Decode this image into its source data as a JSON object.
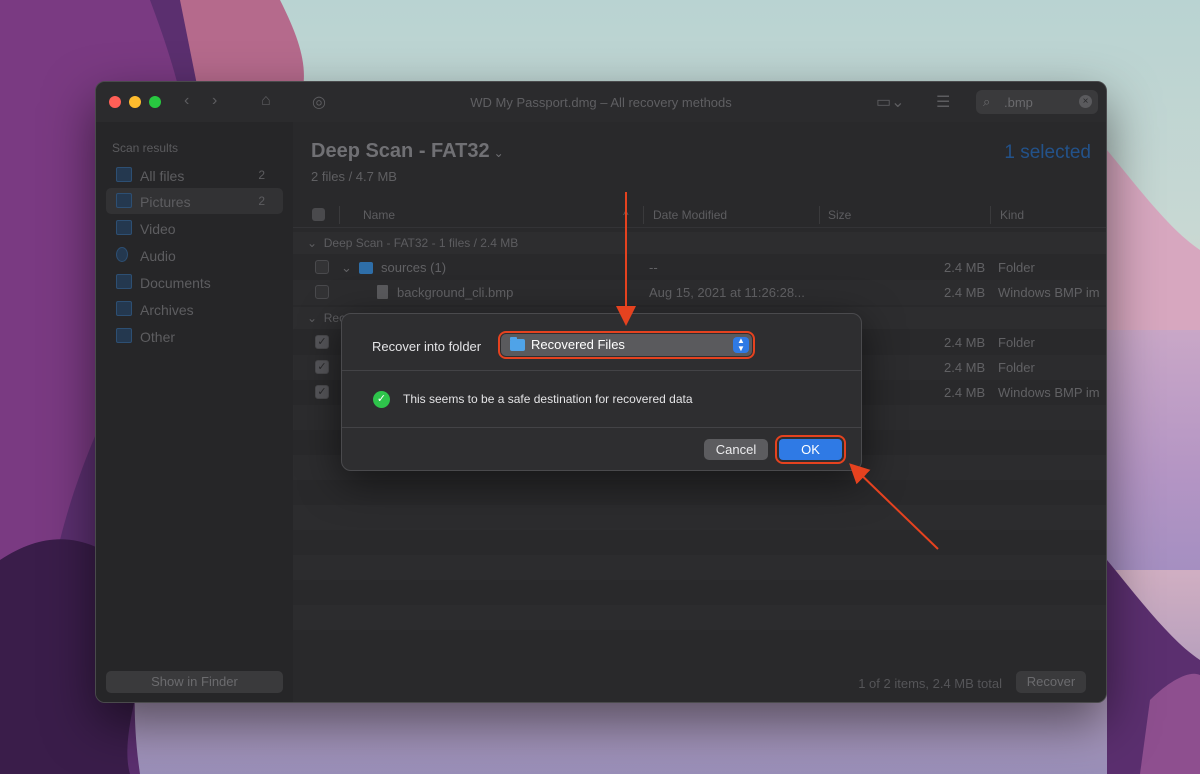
{
  "window": {
    "title": "WD My Passport.dmg – All recovery methods",
    "search_value": ".bmp"
  },
  "sidebar": {
    "header": "Scan results",
    "items": [
      {
        "label": "All files",
        "count": "2"
      },
      {
        "label": "Pictures",
        "count": "2"
      },
      {
        "label": "Video",
        "count": ""
      },
      {
        "label": "Audio",
        "count": ""
      },
      {
        "label": "Documents",
        "count": ""
      },
      {
        "label": "Archives",
        "count": ""
      },
      {
        "label": "Other",
        "count": ""
      }
    ],
    "show_in_finder": "Show in Finder"
  },
  "main": {
    "title": "Deep Scan - FAT32",
    "subtitle": "2 files / 4.7 MB",
    "selected": "1 selected",
    "columns": [
      "Name",
      "Date Modified",
      "Size",
      "Kind"
    ],
    "group1": "Deep Scan - FAT32 - 1 files / 2.4 MB",
    "group2": "Rec",
    "rows": [
      {
        "name": "sources (1)",
        "date": "--",
        "size": "2.4 MB",
        "kind": "Folder"
      },
      {
        "name": "background_cli.bmp",
        "date": "Aug 15, 2021 at 11:26:28...",
        "size": "2.4 MB",
        "kind": "Windows BMP im"
      },
      {
        "name": "",
        "date": "",
        "size": "2.4 MB",
        "kind": "Folder"
      },
      {
        "name": "",
        "date": "",
        "size": "2.4 MB",
        "kind": "Folder"
      },
      {
        "name": "",
        "date": "",
        "size": "2.4 MB",
        "kind": "Windows BMP im"
      }
    ],
    "items_total": "1 of 2 items, 2.4 MB total",
    "recover_button": "Recover"
  },
  "dialog": {
    "label": "Recover into folder",
    "folder_value": "Recovered Files",
    "safe_message": "This seems to be a safe destination for recovered data",
    "cancel": "Cancel",
    "ok": "OK"
  },
  "colors": {
    "accent": "#2f7ae5",
    "annotation": "#e5421f",
    "success": "#2ec44b"
  }
}
